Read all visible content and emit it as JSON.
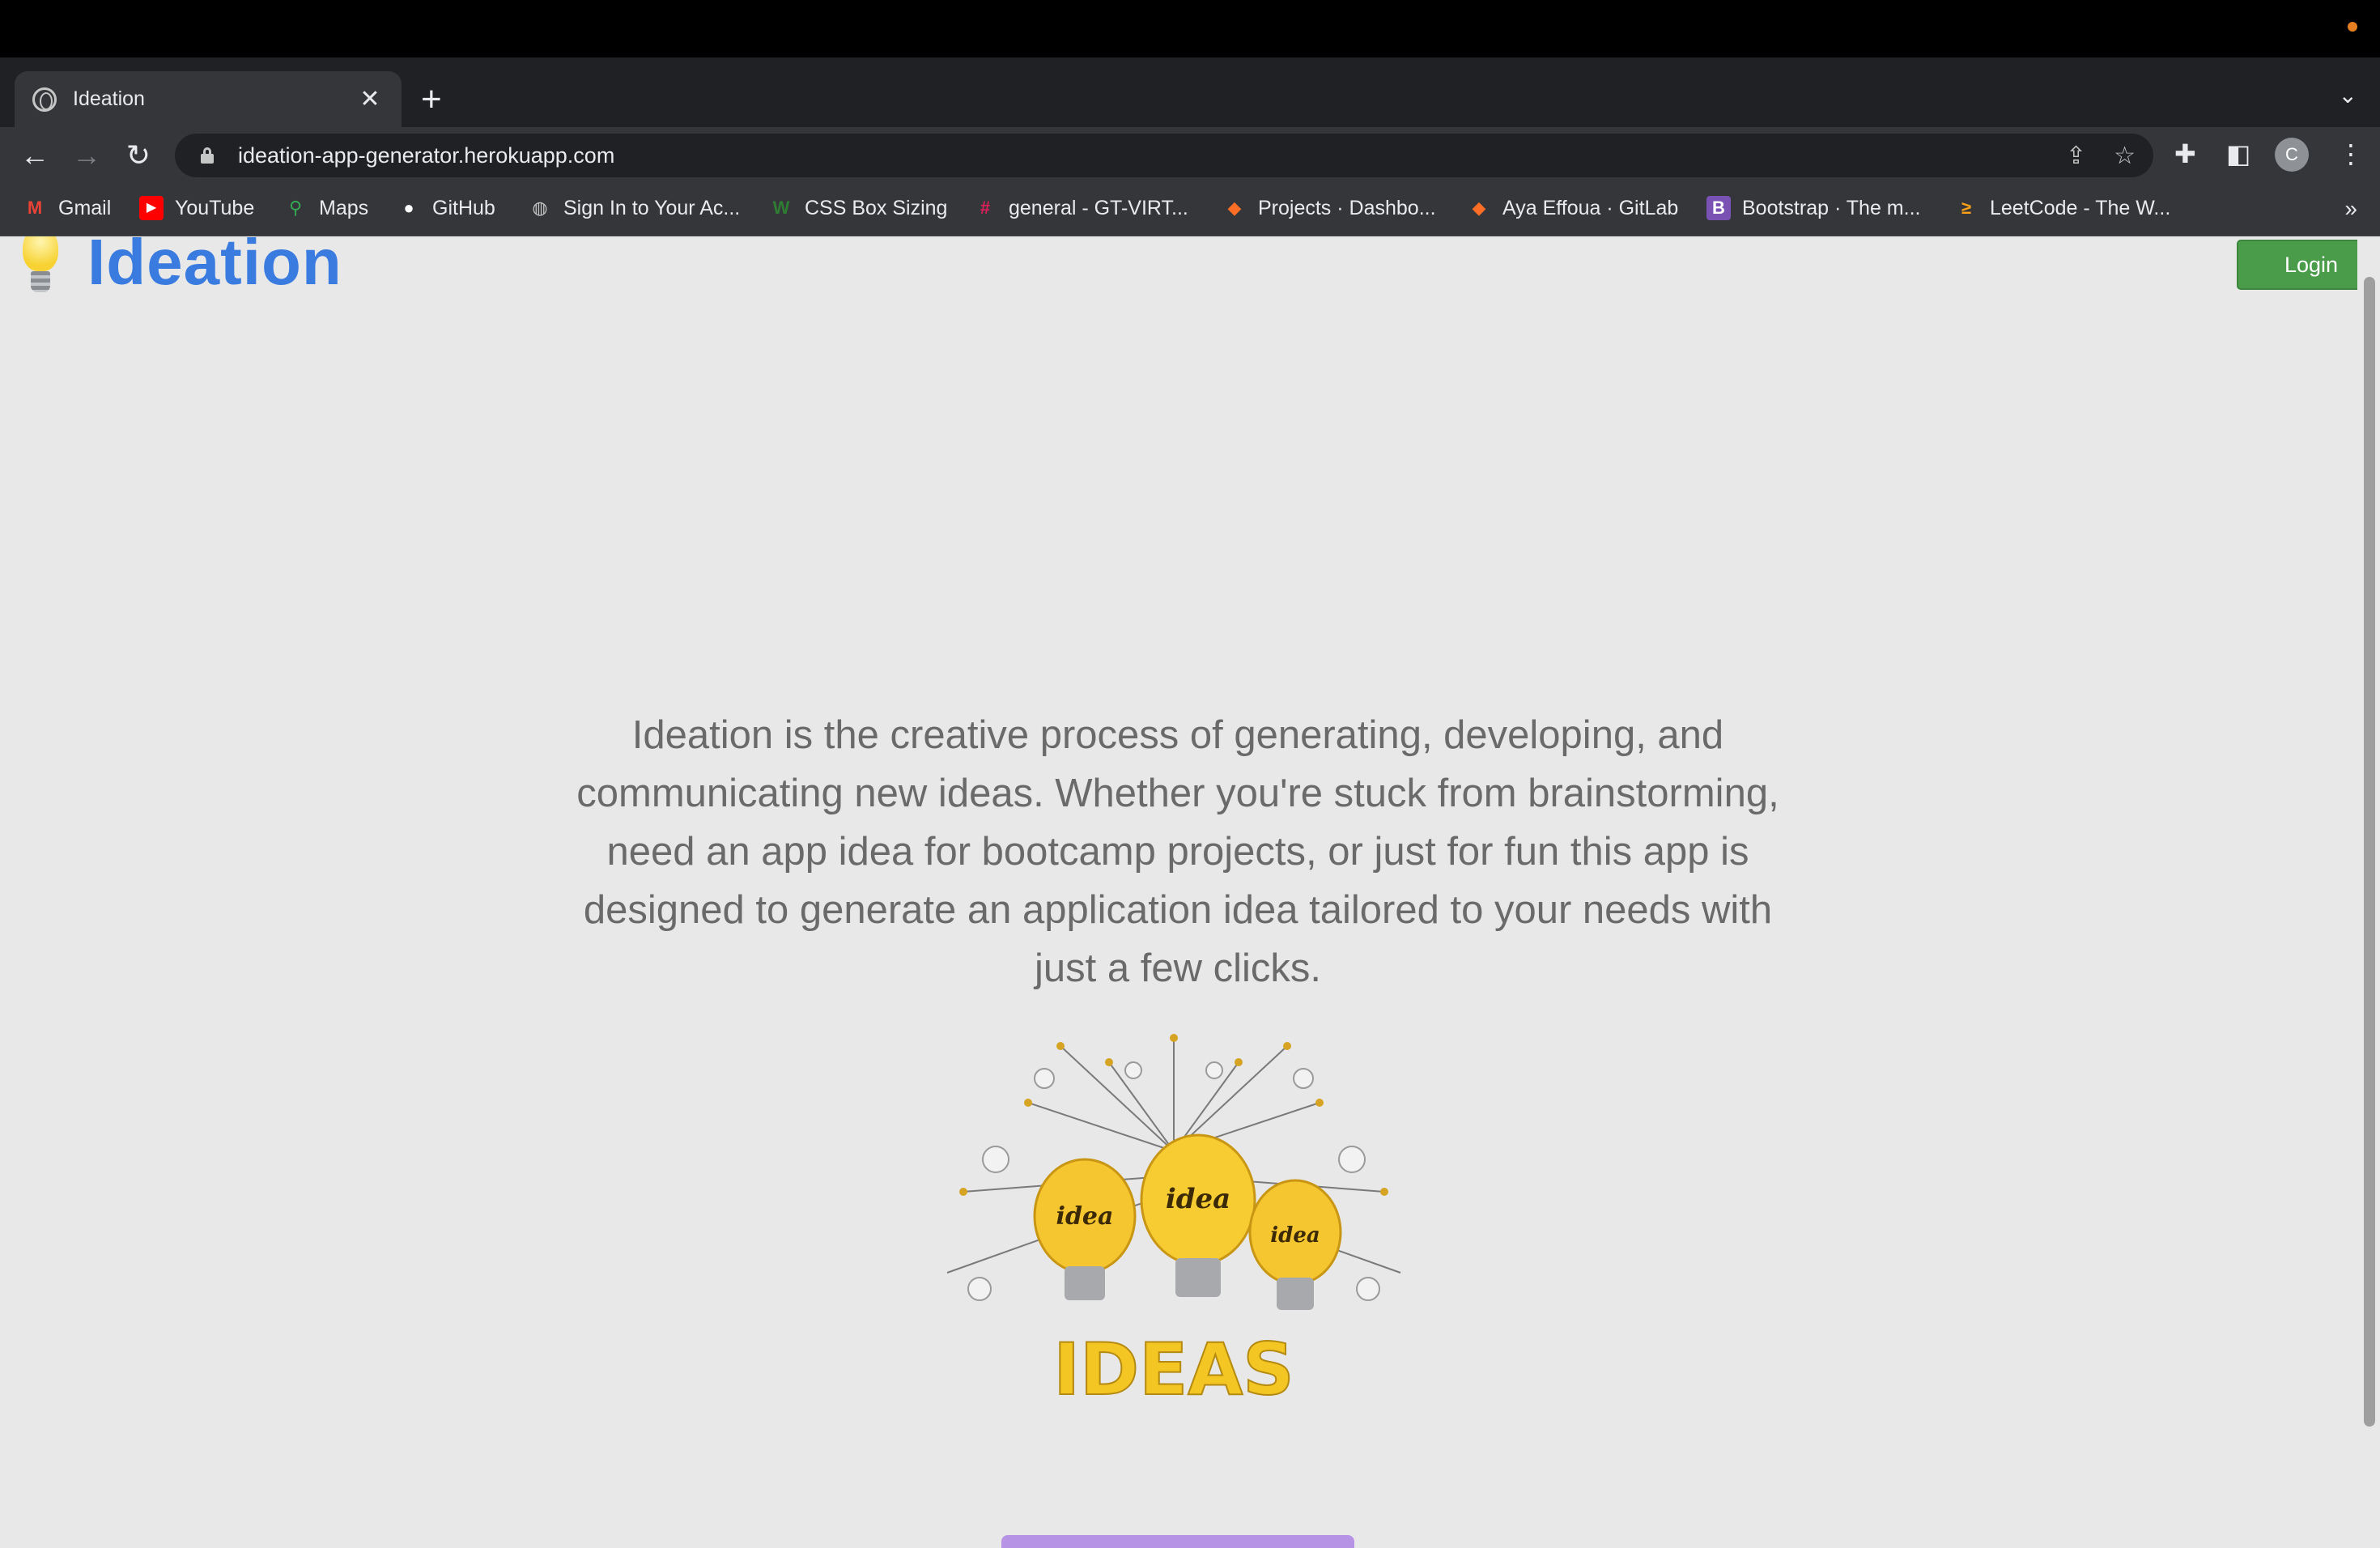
{
  "browser": {
    "tab": {
      "title": "Ideation",
      "close": "✕"
    },
    "new_tab": "+",
    "tab_menu": "⌄",
    "nav": {
      "back": "←",
      "forward": "→",
      "reload": "↻"
    },
    "url": "ideation-app-generator.herokuapp.com",
    "omnibox_icons": {
      "share": "⇪",
      "star": "☆"
    },
    "toolbar_icons": {
      "extensions": "✚",
      "sidepanel": "◧",
      "menu": "⋮"
    },
    "profile_initial": "C",
    "bookmarks": [
      {
        "label": "Gmail",
        "icon": "M",
        "color": "#ea4335"
      },
      {
        "label": "YouTube",
        "icon": "▶",
        "color": "#ff0000"
      },
      {
        "label": "Maps",
        "icon": "⚲",
        "color": "#34a853"
      },
      {
        "label": "GitHub",
        "icon": "●",
        "color": "#ffffff"
      },
      {
        "label": "Sign In to Your Ac...",
        "icon": "◍",
        "color": "#c4c7c5"
      },
      {
        "label": "CSS Box Sizing",
        "icon": "W",
        "color": "#2e7d32"
      },
      {
        "label": "general - GT-VIRT...",
        "icon": "#",
        "color": "#e01e5a"
      },
      {
        "label": "Projects · Dashbo...",
        "icon": "◆",
        "color": "#fc6d26"
      },
      {
        "label": "Aya Effoua · GitLab",
        "icon": "◆",
        "color": "#fc6d26"
      },
      {
        "label": "Bootstrap · The m...",
        "icon": "B",
        "color": "#7952b3"
      },
      {
        "label": "LeetCode - The W...",
        "icon": "≥",
        "color": "#ffa116"
      }
    ],
    "bookmarks_more": "»"
  },
  "page": {
    "brand": "Ideation",
    "login_label": "Login",
    "description": "Ideation is the creative process of generating, developing, and communicating new ideas. Whether you're stuck from brainstorming, need an app idea for bootcamp projects, or just for fun this app is designed to generate an application idea tailored to your needs with just a few clicks.",
    "illustration": {
      "bulb_text": [
        "idea",
        "idea",
        "idea"
      ],
      "headline": "IDEAS"
    }
  }
}
